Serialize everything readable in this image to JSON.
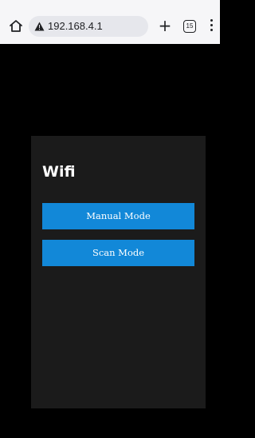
{
  "browser": {
    "url": "192.168.4.1",
    "tab_count": "15",
    "new_tab_symbol": "+"
  },
  "panel": {
    "title": "Wifi",
    "buttons": [
      {
        "label": "Manual Mode"
      },
      {
        "label": "Scan Mode"
      }
    ]
  },
  "colors": {
    "page_background": "#000000",
    "panel_background": "#1b1b1b",
    "button_background": "#1288d8",
    "button_text": "#ffffff"
  },
  "icons": {
    "home": "home-icon",
    "warning": "not-secure-warning-icon",
    "new_tab": "plus-icon",
    "tabs": "tab-switcher-icon",
    "menu": "more-vert-icon"
  }
}
